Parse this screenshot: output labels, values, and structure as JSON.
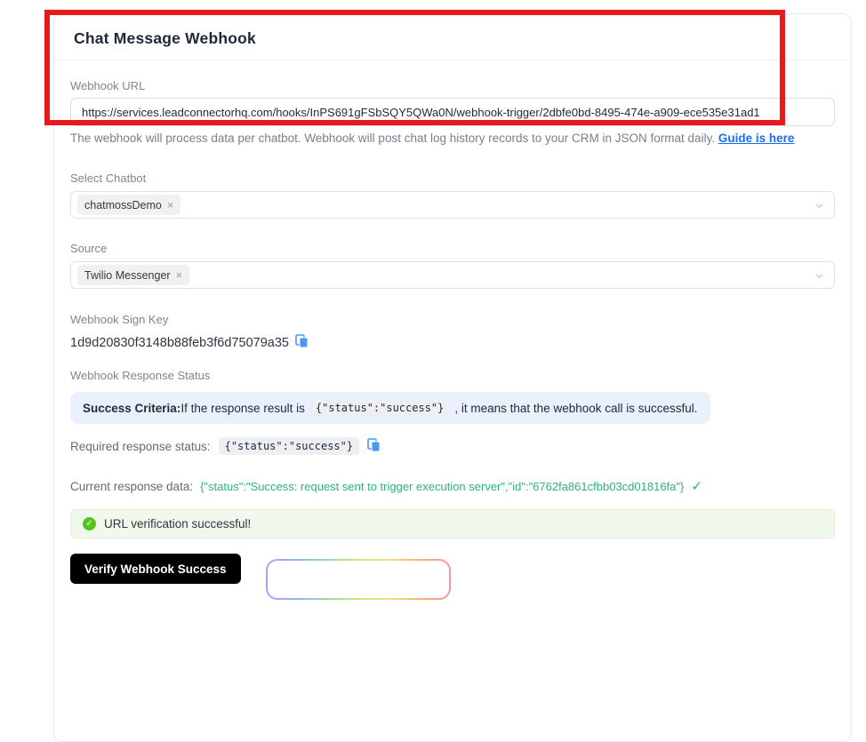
{
  "card": {
    "title": "Chat Message Webhook",
    "webhook_url": {
      "label": "Webhook URL",
      "value": "https://services.leadconnectorhq.com/hooks/InPS691gFSbSQY5QWa0N/webhook-trigger/2dbfe0bd-8495-474e-a909-ece535e31ad1",
      "help_text": "The webhook will process data per chatbot. Webhook will post chat log history records to your CRM in JSON format daily. ",
      "help_link": "Guide is here"
    },
    "select_chatbot": {
      "label": "Select Chatbot",
      "selected": [
        {
          "label": "chatmossDemo"
        }
      ],
      "remove_icon": "×"
    },
    "source": {
      "label": "Source",
      "selected": [
        {
          "label": "Twilio Messenger"
        }
      ],
      "remove_icon": "×"
    },
    "sign_key": {
      "label": "Webhook Sign Key",
      "value": "1d9d20830f3148b88feb3f6d75079a35"
    },
    "response_status": {
      "label": "Webhook Response Status",
      "criteria_title": "Success Criteria:",
      "criteria_before": " If the response result is",
      "criteria_code": "{\"status\":\"success\"}",
      "criteria_after": ", it means that the webhook call is successful."
    },
    "required_status": {
      "label": "Required response status:",
      "code": "{\"status\":\"success\"}"
    },
    "current_response": {
      "label": "Current response data:",
      "value": "{\"status\":\"Success: request sent to trigger execution server\",\"id\":\"6762fa861cfbb03cd01816fa\"}",
      "check_icon": "✓"
    },
    "alert": {
      "check_icon": "✓",
      "text": "URL verification successful!"
    },
    "verify_button_label": "Verify Webhook Success"
  },
  "colors": {
    "annotation_red": "#e8191d",
    "link_blue": "#1a6ef2",
    "success_green": "#2bb673",
    "alert_icon_green": "#52c41a",
    "button_black": "#000000"
  }
}
